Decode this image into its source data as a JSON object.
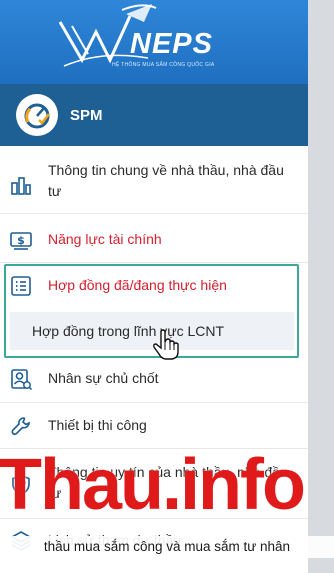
{
  "brand": {
    "name": "NEPS",
    "tagline": "HỆ THỐNG MUA SẮM CÔNG QUỐC GIA"
  },
  "module": {
    "title": "SPM",
    "icon": "gauge-check-icon"
  },
  "menu": [
    {
      "label": "Thông tin chung về nhà thầu, nhà đầu tư",
      "icon": "building-chart-icon",
      "active": false
    },
    {
      "label": "Năng lực tài chính",
      "icon": "dollar-card-icon",
      "active": true
    },
    {
      "label": "Hợp đồng đã/đang thực hiện",
      "icon": "list-icon",
      "active": true
    },
    {
      "label": "Nhân sự chủ chốt",
      "icon": "person-card-icon",
      "active": false
    },
    {
      "label": "Thiết bị thi công",
      "icon": "wrench-icon",
      "active": false
    },
    {
      "label": "Thông tin uy tín của nhà thầu, nhà đầu tư",
      "icon": "shield-check-icon",
      "active": false
    },
    {
      "label": "Lịch sử tham dự thầu",
      "icon": "layers-icon",
      "active": false
    }
  ],
  "submenu": {
    "label": "Hợp đồng trong lĩnh vực LCNT"
  },
  "watermark": {
    "text": "Thau.info",
    "caption": "thầu mua sắm công và mua sắm tư nhân"
  },
  "colors": {
    "brand_blue": "#2f86d8",
    "header_navy": "#1e5f94",
    "active_red": "#d6202f",
    "highlight_teal": "#3aa89a",
    "watermark_red": "#e01a1a"
  }
}
